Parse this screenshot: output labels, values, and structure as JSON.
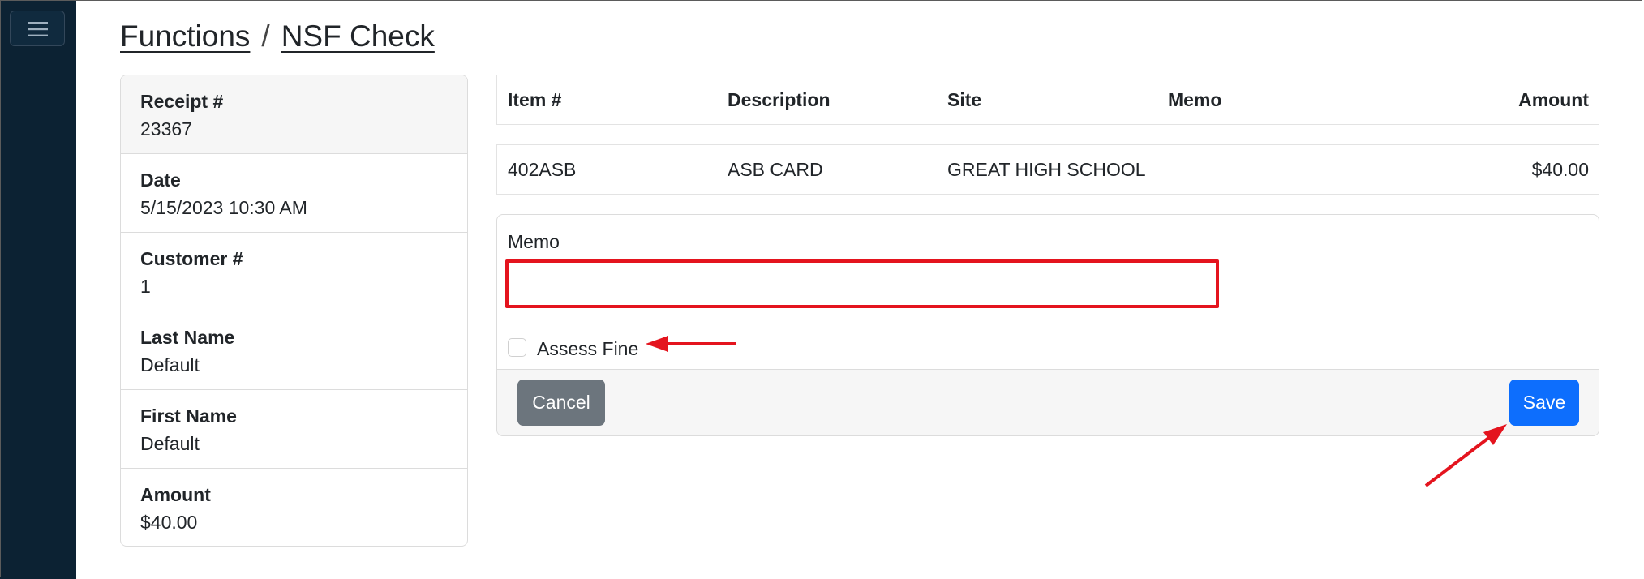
{
  "breadcrumb": {
    "functions": "Functions",
    "separator": "/",
    "current": "NSF Check"
  },
  "receipt_info": [
    {
      "label": "Receipt #",
      "value": "23367"
    },
    {
      "label": "Date",
      "value": "5/15/2023 10:30 AM"
    },
    {
      "label": "Customer #",
      "value": "1"
    },
    {
      "label": "Last Name",
      "value": "Default"
    },
    {
      "label": "First Name",
      "value": "Default"
    },
    {
      "label": "Amount",
      "value": "$40.00"
    }
  ],
  "table": {
    "headers": {
      "item": "Item #",
      "description": "Description",
      "site": "Site",
      "memo": "Memo",
      "amount": "Amount"
    },
    "rows": [
      {
        "item": "402ASB",
        "description": "ASB CARD",
        "site": "GREAT HIGH SCHOOL",
        "memo": "",
        "amount": "$40.00"
      }
    ]
  },
  "memo_form": {
    "label": "Memo",
    "value": "",
    "assess_fine_label": "Assess Fine",
    "assess_fine_checked": false,
    "cancel_label": "Cancel",
    "save_label": "Save"
  },
  "colors": {
    "sidebar": "#0c2233",
    "primary": "#0d6efd",
    "secondary": "#6c757d",
    "annotation": "#e4141e"
  },
  "icons": {
    "menu": "hamburger-menu-icon",
    "annotation_arrows": "red-arrow-icon"
  }
}
